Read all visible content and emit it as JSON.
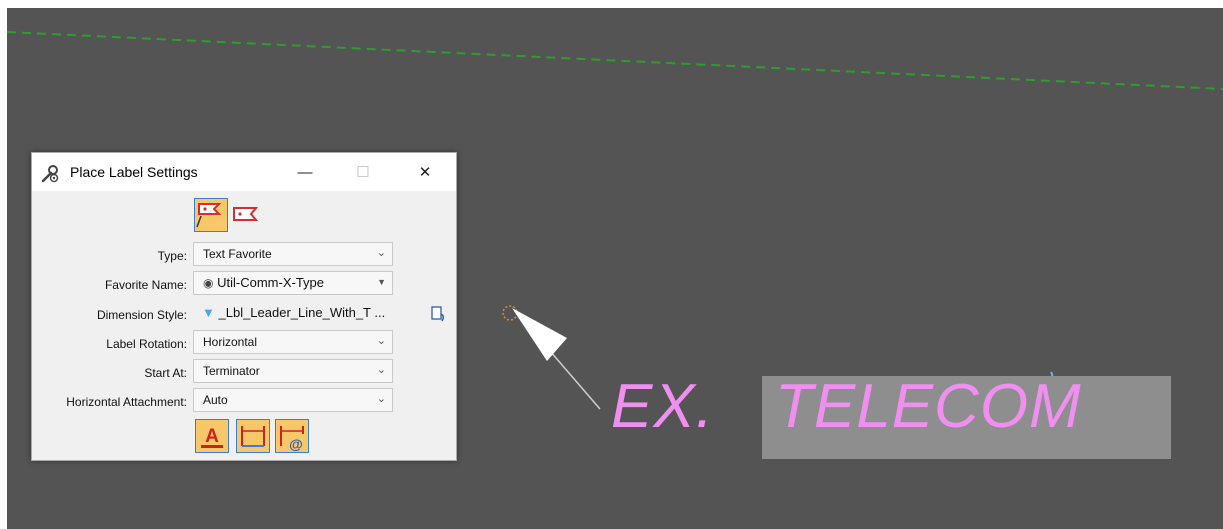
{
  "window": {
    "title": "Place Label Settings",
    "minimize": "—",
    "maximize": "☐",
    "close": "✕"
  },
  "form": {
    "type": {
      "label": "Type:",
      "value": "Text Favorite"
    },
    "favorite_name": {
      "label": "Favorite Name:",
      "value": "Util-Comm-X-Type"
    },
    "dimension_style": {
      "label": "Dimension Style:",
      "value": "_Lbl_Leader_Line_With_T ..."
    },
    "label_rotation": {
      "label": "Label Rotation:",
      "value": "Horizontal"
    },
    "start_at": {
      "label": "Start At:",
      "value": "Terminator"
    },
    "horizontal_attachment": {
      "label": "Horizontal Attachment:",
      "value": "Auto"
    }
  },
  "canvas_label": {
    "prefix": "EX.",
    "main": "TELECOM"
  },
  "colors": {
    "canvas_bg": "#545454",
    "dashed_line": "#2e9d2e",
    "label_text": "#ef8ff0",
    "selected_tool": "#f6c86a"
  }
}
